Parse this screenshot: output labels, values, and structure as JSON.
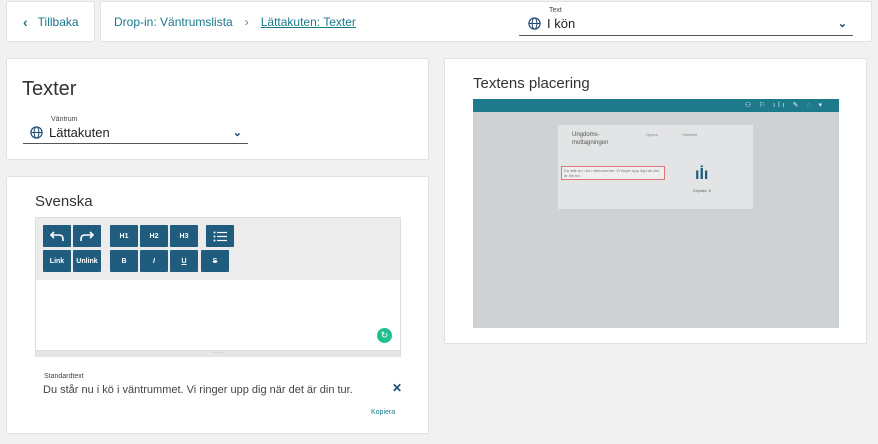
{
  "nav": {
    "back_label": "Tillbaka",
    "breadcrumb_parent": "Drop-in: Väntrumslista",
    "breadcrumb_current": "Lättakuten: Texter"
  },
  "text_select": {
    "label": "Text",
    "value": "I kön"
  },
  "texter": {
    "title": "Texter",
    "rum_label": "Väntrum",
    "rum_value": "Lättakuten"
  },
  "svenska": {
    "title": "Svenska",
    "toolbar": {
      "undo": "undo-icon",
      "redo": "redo-icon",
      "h1": "H1",
      "h2": "H2",
      "h3": "H3",
      "list": "list-icon",
      "link": "Link",
      "unlink": "Unlink",
      "bold": "B",
      "italic": "I",
      "underline": "U",
      "strike": "S"
    },
    "resize_handle": "······",
    "standard_label": "Standardtext",
    "standard_text": "Du står nu i kö i väntrummet. Vi ringer upp dig när det är din tur.",
    "close": "✕",
    "copy_label": "Kopiera"
  },
  "placement": {
    "title": "Textens placering",
    "preview": {
      "header_icons": "⚇ ⚐ ılı ✎ ◌ ▾",
      "clinic_name": "Ungdoms-\nmottagningen",
      "stat_a": "Öppen",
      "stat_b": "Väntetid",
      "message": "Du står nu i kö i väntrummet. Vi ringer upp dig när det är din tur.",
      "people_icon": "ıİı",
      "queue_label": "Köplats: 5"
    }
  },
  "colors": {
    "accent": "#187a8c",
    "button": "#1f5c7e",
    "preview_header": "#1d7a8a",
    "background": "#f1f1f1"
  }
}
